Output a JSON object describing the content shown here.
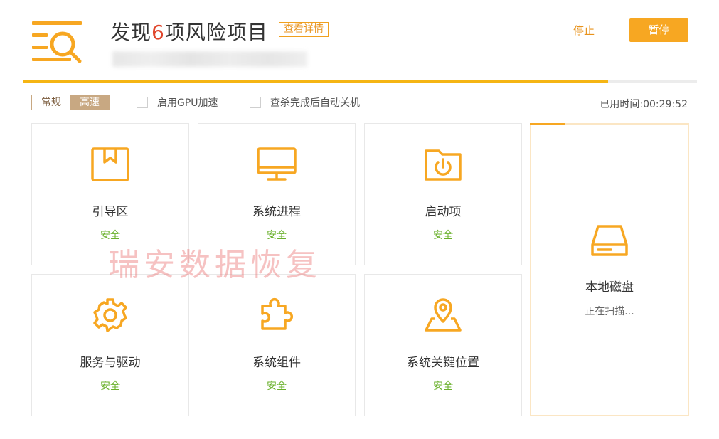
{
  "header": {
    "title_prefix": "发现",
    "title_count": "6",
    "title_suffix": "项风险项目",
    "details_label": "查看详情",
    "stop_label": "停止",
    "pause_label": "暂停",
    "progress_fraction": 0.868
  },
  "options": {
    "mode_normal": "常规",
    "mode_fast": "高速",
    "mode_selected": "高速",
    "gpu_label": "启用GPU加速",
    "gpu_checked": false,
    "shutdown_label": "查杀完成后自动关机",
    "shutdown_checked": false,
    "elapsed_label": "已用时间:",
    "elapsed_value": "00:29:52"
  },
  "cards": [
    {
      "name": "引导区",
      "status": "安全",
      "icon": "bookmark-box-icon"
    },
    {
      "name": "系统进程",
      "status": "安全",
      "icon": "monitor-icon"
    },
    {
      "name": "启动项",
      "status": "安全",
      "icon": "power-folder-icon"
    },
    {
      "name": "服务与驱动",
      "status": "安全",
      "icon": "gear-icon"
    },
    {
      "name": "系统组件",
      "status": "安全",
      "icon": "puzzle-icon"
    },
    {
      "name": "系统关键位置",
      "status": "安全",
      "icon": "map-pin-icon"
    }
  ],
  "scanning_card": {
    "name": "本地磁盘",
    "status": "正在扫描...",
    "icon": "hard-disk-icon"
  },
  "watermark": "瑞安数据恢复",
  "colors": {
    "accent": "#f7a722",
    "safe": "#6ab02b",
    "danger": "#e0452b",
    "mode_active": "#c8a882"
  }
}
